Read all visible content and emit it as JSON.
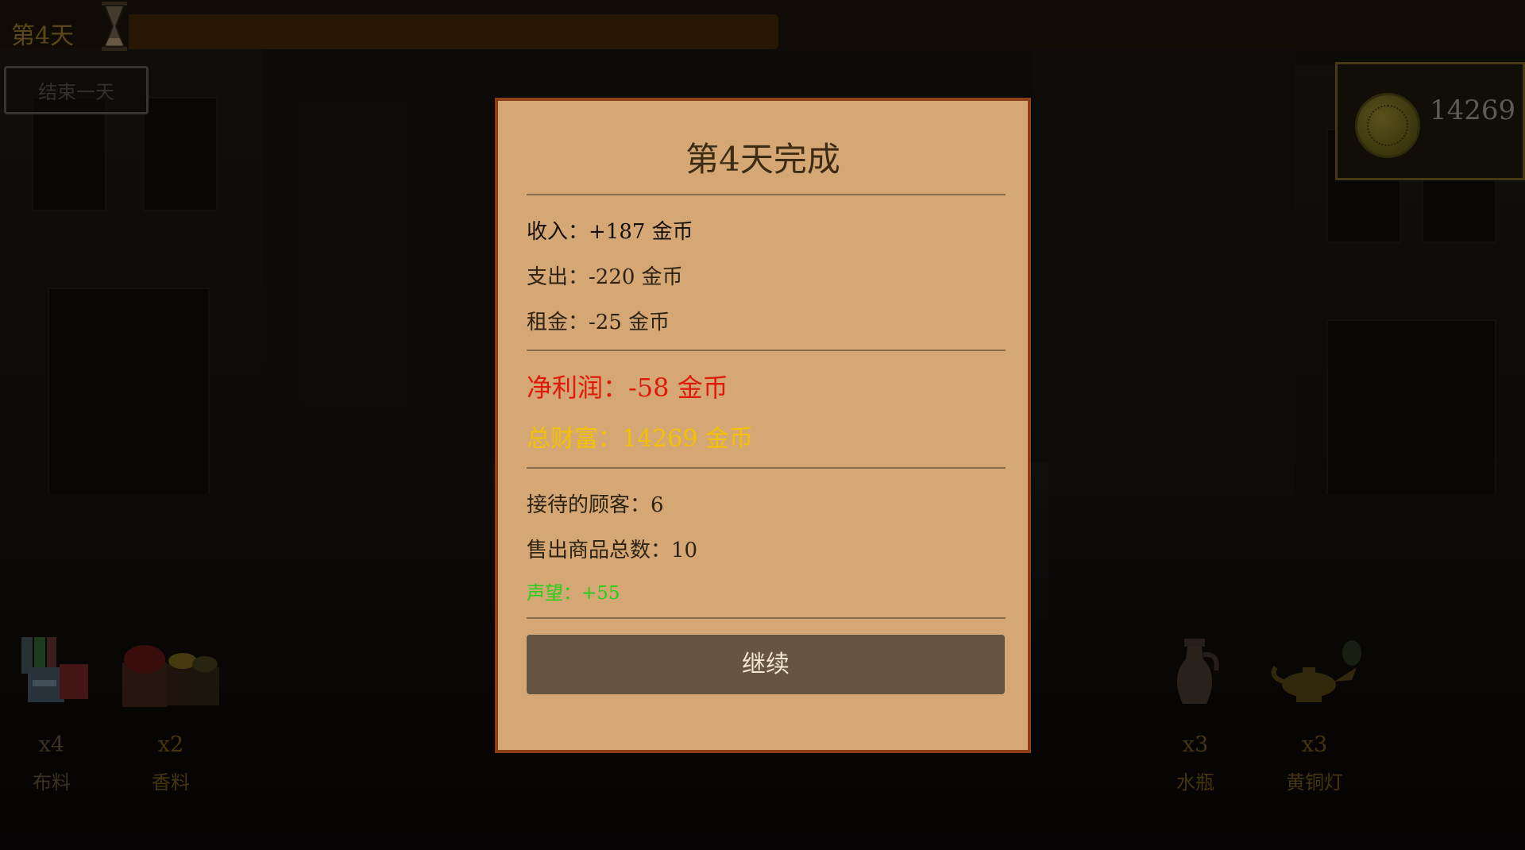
{
  "top_bar": {
    "day_label": "第4天",
    "day_progress": 0.0
  },
  "controls": {
    "end_day_label": "结束一天"
  },
  "gold_panel": {
    "amount": "14269",
    "icon": "gold-coin-icon"
  },
  "inventory": {
    "left": [
      {
        "icon": "cloth-icon",
        "count": "x4",
        "name": "布料"
      },
      {
        "icon": "spice-icon",
        "count": "x2",
        "name": "香料"
      }
    ],
    "right": [
      {
        "icon": "water-jug-icon",
        "count": "x3",
        "name": "水瓶"
      },
      {
        "icon": "brass-lamp-icon",
        "count": "x3",
        "name": "黄铜灯"
      }
    ]
  },
  "summary_dialog": {
    "title": "第4天完成",
    "income": "收入：+187 金币",
    "expense": "支出：-220 金币",
    "rent": "租金：-25 金币",
    "net_profit": "净利润：-58 金币",
    "total_wealth": "总财富：14269 金币",
    "customers": "接待的顾客：6",
    "items_sold": "售出商品总数：10",
    "reputation": "声望：+55",
    "continue_label": "继续"
  },
  "colors": {
    "dialog_bg": "#d4a774",
    "dialog_border": "#8b3f12",
    "profit_negative": "#e01a0a",
    "wealth": "#f2c100",
    "reputation": "#22d01a",
    "button_bg": "#655541"
  }
}
